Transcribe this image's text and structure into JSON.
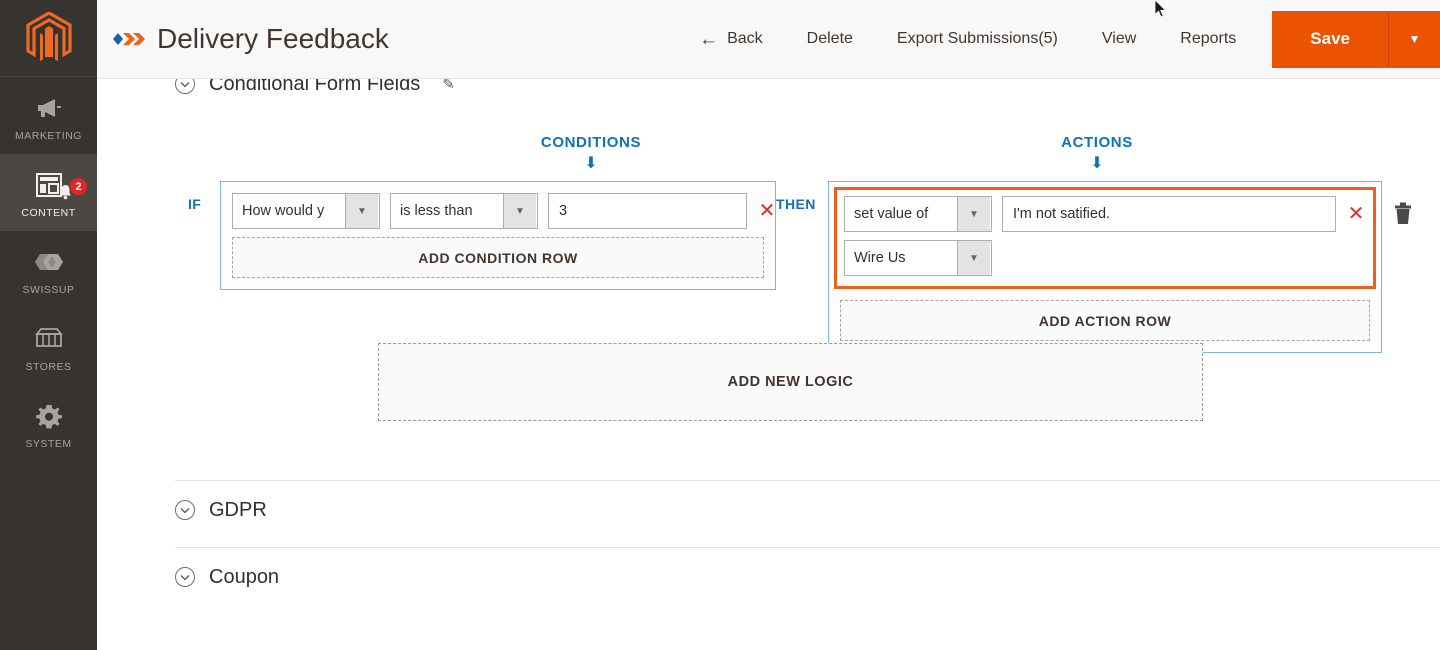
{
  "sidebar": {
    "logo_icon": "magento-logo-icon",
    "items": [
      {
        "label": "MARKETING",
        "icon": "megaphone-icon",
        "active": false,
        "badge": null
      },
      {
        "label": "CONTENT",
        "icon": "layout-icon",
        "active": true,
        "badge": "2"
      },
      {
        "label": "SWISSUP",
        "icon": "swissup-hexagons-icon",
        "active": false,
        "badge": null
      },
      {
        "label": "STORES",
        "icon": "storefront-icon",
        "active": false,
        "badge": null
      },
      {
        "label": "SYSTEM",
        "icon": "gear-icon",
        "active": false,
        "badge": null
      }
    ]
  },
  "header": {
    "brand_icon": "swissup-chevrons-icon",
    "title": "Delivery Feedback",
    "back_icon": "arrow-left-icon",
    "back_label": "Back",
    "delete_label": "Delete",
    "export_label": "Export Submissions(5)",
    "view_label": "View",
    "reports_label": "Reports",
    "save_label": "Save",
    "save_caret_icon": "caret-down-icon"
  },
  "sections": {
    "conditional_form_fields": {
      "title": "Conditional Form Fields",
      "toggle_icon": "circle-chevron-icon",
      "edit_icon": "pencil-icon"
    },
    "gdpr": {
      "title": "GDPR",
      "toggle_icon": "circle-chevron-icon"
    },
    "coupon": {
      "title": "Coupon",
      "toggle_icon": "circle-chevron-icon"
    }
  },
  "logic": {
    "conditions_heading": "CONDITIONS",
    "actions_heading": "ACTIONS",
    "arrow_icon": "arrow-down-icon",
    "if_label": "IF",
    "then_label": "THEN",
    "conditions": {
      "rows": [
        {
          "field_value": "How would y",
          "operator_value": "is less than",
          "input_value": "3",
          "remove_icon": "x-icon"
        }
      ],
      "add_row_label": "ADD CONDITION ROW"
    },
    "actions": {
      "highlighted": true,
      "rows": [
        {
          "action_value": "set value of",
          "input_value": "I'm not satified.",
          "remove_icon": "x-icon"
        },
        {
          "target_value": "Wire Us"
        }
      ],
      "add_row_label": "ADD ACTION ROW",
      "delete_icon": "trash-icon"
    },
    "add_new_logic_label": "ADD NEW LOGIC"
  },
  "colors": {
    "accent_orange": "#eb5202",
    "highlight_orange": "#ee5f1a",
    "link_blue": "#0f72b5",
    "panel_border_blue": "#7bb7dd",
    "remove_red": "#e02b27",
    "badge_red": "#e22626",
    "sidebar_bg": "#373330"
  }
}
